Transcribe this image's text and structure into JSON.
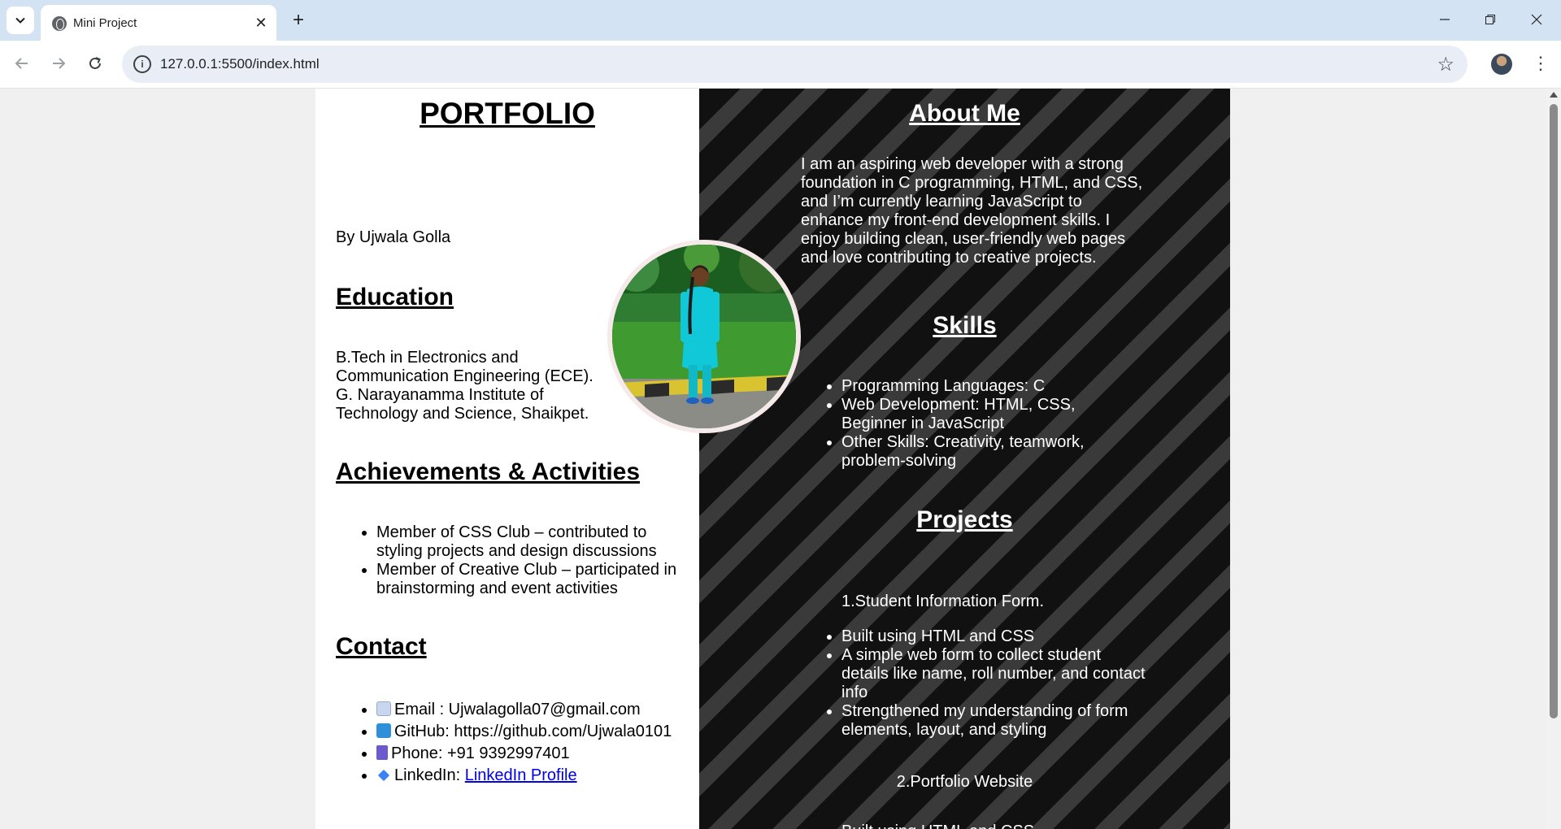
{
  "browser": {
    "tab_title": "Mini Project",
    "url": "127.0.0.1:5500/index.html"
  },
  "page": {
    "title": "PORTFOLIO",
    "byline": "By Ujwala Golla",
    "education": {
      "heading": "Education",
      "lines": [
        "B.Tech in Electronics and",
        "Communication Engineering (ECE).",
        "G. Narayanamma Institute of",
        "Technology and Science, Shaikpet."
      ]
    },
    "achievements": {
      "heading": "Achievements & Activities",
      "items": [
        "Member of CSS Club – contributed to styling projects and design discussions",
        "Member of Creative Club – participated in brainstorming and event activities"
      ]
    },
    "contact": {
      "heading": "Contact",
      "email": "Email : Ujwalagolla07@gmail.com",
      "github": "GitHub: https://github.com/Ujwala0101",
      "phone": "Phone: +91 9392997401",
      "linkedin_prefix": "LinkedIn: ",
      "linkedin_link": "LinkedIn Profile"
    },
    "about": {
      "heading": "About Me",
      "text": "I am an aspiring web developer with a strong foundation in C programming, HTML, and CSS, and I’m currently learning JavaScript to enhance my front-end development skills. I enjoy building clean, user-friendly web pages and love contributing to creative projects."
    },
    "skills": {
      "heading": "Skills",
      "items": [
        "Programming Languages: C",
        "Web Development: HTML, CSS, Beginner in JavaScript",
        "Other Skills: Creativity, teamwork, problem-solving"
      ]
    },
    "projects": {
      "heading": "Projects",
      "project1_title": "1.Student Information Form.",
      "project1_items": [
        "Built using HTML and CSS",
        "A simple web form to collect student details like name, roll number, and contact info",
        "Strengthened my understanding of form elements, layout, and styling"
      ],
      "project2_title": "2.Portfolio Website",
      "project2_partial": "Built using HTML and CSS"
    }
  }
}
